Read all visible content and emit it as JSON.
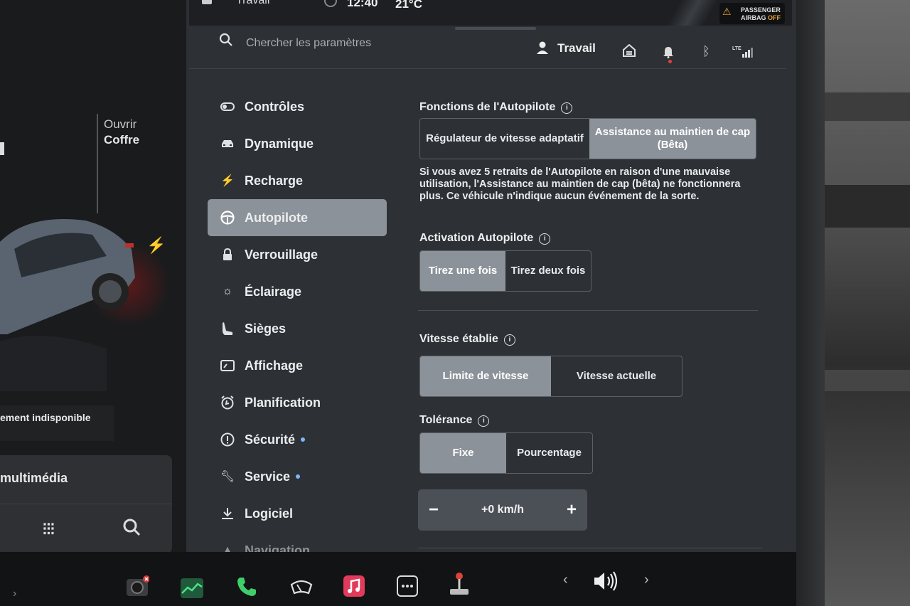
{
  "status_bar": {
    "profile": "Travail",
    "time": "12:40",
    "temperature": "21°C",
    "airbag_line1": "PASSENGER",
    "airbag_line2": "AIRBAG",
    "airbag_state": "OFF"
  },
  "header": {
    "search_placeholder": "Chercher les paramètres",
    "profile_name": "Travail",
    "icons": [
      "home-icon",
      "bell-icon",
      "bluetooth-icon",
      "lte-signal-icon"
    ],
    "lte_label": "LTE"
  },
  "car_panel": {
    "trunk_action": "Ouvrir",
    "trunk_label": "Coffre",
    "status_text": "ement indisponible",
    "media_title": "multimédia"
  },
  "nav": {
    "items": [
      {
        "label": "Contrôles",
        "icon": "toggle-icon"
      },
      {
        "label": "Dynamique",
        "icon": "car-icon"
      },
      {
        "label": "Recharge",
        "icon": "bolt-icon"
      },
      {
        "label": "Autopilote",
        "icon": "steering-wheel-icon",
        "active": true
      },
      {
        "label": "Verrouillage",
        "icon": "lock-icon"
      },
      {
        "label": "Éclairage",
        "icon": "sun-icon"
      },
      {
        "label": "Sièges",
        "icon": "seat-icon"
      },
      {
        "label": "Affichage",
        "icon": "display-icon"
      },
      {
        "label": "Planification",
        "icon": "alarm-icon"
      },
      {
        "label": "Sécurité",
        "icon": "alert-icon",
        "badge": true
      },
      {
        "label": "Service",
        "icon": "wrench-icon",
        "badge": true
      },
      {
        "label": "Logiciel",
        "icon": "download-icon"
      },
      {
        "label": "Navigation",
        "icon": "navigation-icon"
      }
    ]
  },
  "autopilot": {
    "features_title": "Fonctions de l'Autopilote",
    "features_options": [
      "Régulateur de vitesse adaptatif",
      "Assistance au maintien de cap (Bêta)"
    ],
    "features_selected": 1,
    "features_desc": "Si vous avez 5 retraits de l'Autopilote en raison d'une mauvaise utilisation, l'Assistance au maintien de cap (bêta) ne fonctionnera plus. Ce véhicule n'indique aucun événement de la sorte.",
    "activation_title": "Activation Autopilote",
    "activation_options": [
      "Tirez une fois",
      "Tirez deux fois"
    ],
    "activation_selected": 0,
    "speed_title": "Vitesse établie",
    "speed_options": [
      "Limite de vitesse",
      "Vitesse actuelle"
    ],
    "speed_selected": 0,
    "tolerance_title": "Tolérance",
    "tolerance_options": [
      "Fixe",
      "Pourcentage"
    ],
    "tolerance_selected": 0,
    "offset_value": "+0 km/h",
    "minus_label": "−",
    "plus_label": "+"
  },
  "dock": {
    "apps": [
      "camera-icon",
      "energy-icon",
      "phone-icon",
      "wiper-icon",
      "music-icon",
      "more-icon",
      "joystick-icon"
    ],
    "volume_icon": "volume-icon"
  },
  "colors": {
    "panel_bg": "#2d3034",
    "selected_bg": "#8c9299",
    "badge_dot": "#7fb4ff",
    "notification_dot": "#e0403a",
    "airbag_amber": "#e8a33a"
  }
}
